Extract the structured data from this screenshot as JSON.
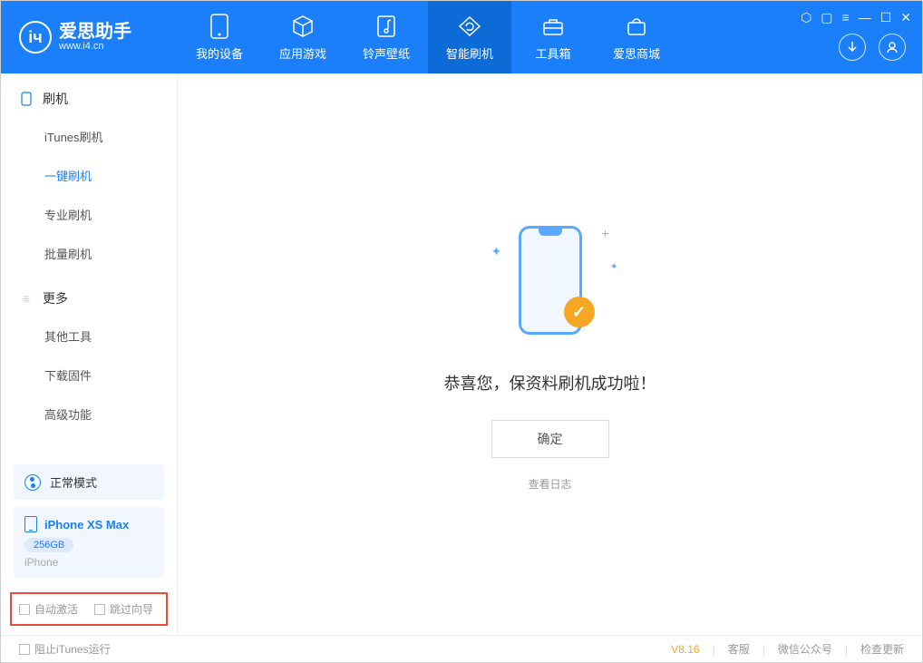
{
  "app": {
    "name": "爱思助手",
    "url": "www.i4.cn"
  },
  "nav": [
    {
      "label": "我的设备",
      "icon": "device"
    },
    {
      "label": "应用游戏",
      "icon": "cube"
    },
    {
      "label": "铃声壁纸",
      "icon": "music"
    },
    {
      "label": "智能刷机",
      "icon": "refresh",
      "active": true
    },
    {
      "label": "工具箱",
      "icon": "toolbox"
    },
    {
      "label": "爱思商城",
      "icon": "shop"
    }
  ],
  "sidebar": {
    "section1": {
      "title": "刷机",
      "items": [
        "iTunes刷机",
        "一键刷机",
        "专业刷机",
        "批量刷机"
      ],
      "activeIndex": 1
    },
    "section2": {
      "title": "更多",
      "items": [
        "其他工具",
        "下载固件",
        "高级功能"
      ]
    },
    "mode": "正常模式",
    "device": {
      "name": "iPhone XS Max",
      "storage": "256GB",
      "type": "iPhone"
    },
    "checkboxes": {
      "auto_activate": "自动激活",
      "skip_guide": "跳过向导"
    }
  },
  "main": {
    "success_msg": "恭喜您，保资料刷机成功啦！",
    "confirm": "确定",
    "view_log": "查看日志"
  },
  "footer": {
    "block_itunes": "阻止iTunes运行",
    "version": "V8.16",
    "links": [
      "客服",
      "微信公众号",
      "检查更新"
    ]
  }
}
